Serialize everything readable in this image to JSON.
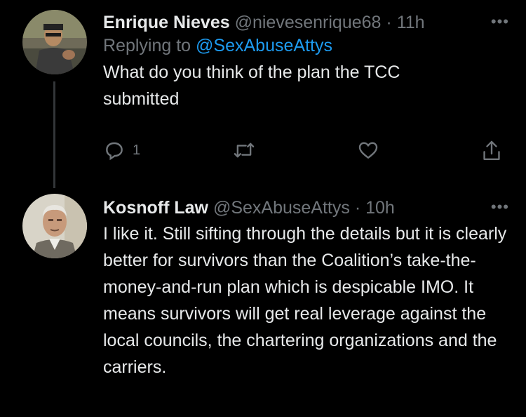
{
  "tweets": [
    {
      "name": "Enrique Nieves",
      "handle": "@nievesenrique68",
      "separator": "·",
      "time": "11h",
      "more": "•••",
      "replying_prefix": "Replying to",
      "replying_handle": "@SexAbuseAttys",
      "text": "What do you think of the plan the TCC submitted",
      "actions": {
        "reply_count": "1",
        "icons": [
          "reply-icon",
          "retweet-icon",
          "like-icon",
          "share-icon"
        ]
      }
    },
    {
      "name": "Kosnoff Law",
      "handle": "@SexAbuseAttys",
      "separator": "·",
      "time": "10h",
      "more": "•••",
      "text": "I like it. Still sifting through the details but it is clearly better for survivors than the Coalition’s take-the-money-and-run plan which is despicable IMO. It means survivors will get real leverage against the local councils, the chartering organizations and the carriers."
    }
  ],
  "colors": {
    "background": "#000000",
    "text": "#e7e9ea",
    "muted": "#71767b",
    "link": "#1d9bf0",
    "thread_line": "#333639"
  }
}
